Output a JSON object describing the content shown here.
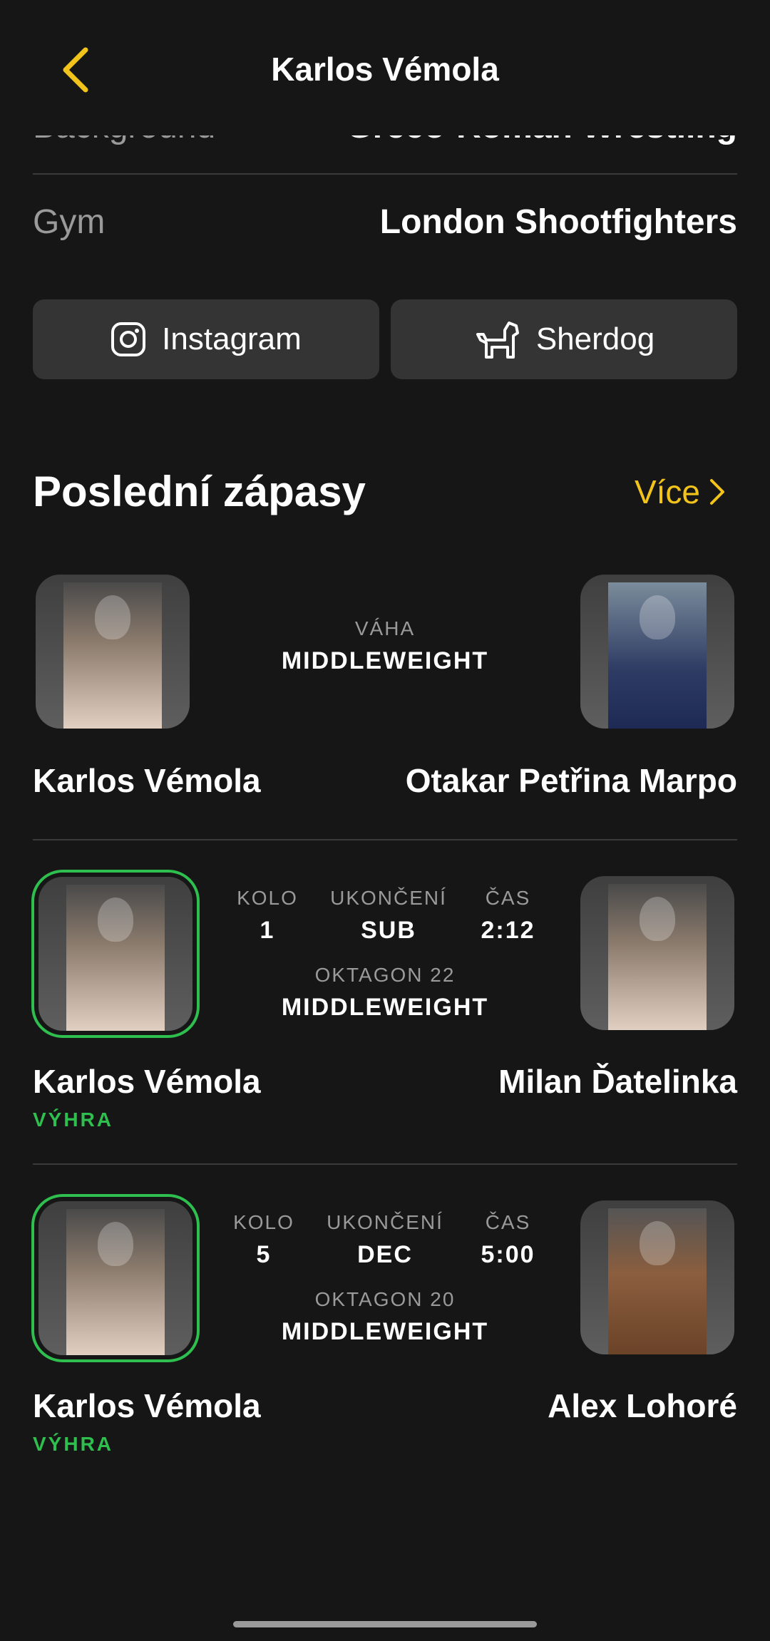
{
  "header": {
    "title": "Karlos Vémola"
  },
  "info": {
    "background_label": "Background",
    "background_value": "Greco-Roman Wrestling",
    "gym_label": "Gym",
    "gym_value": "London Shootfighters"
  },
  "links": {
    "instagram": "Instagram",
    "sherdog": "Sherdog"
  },
  "section": {
    "title": "Poslední zápasy",
    "more": "Více"
  },
  "colors": {
    "accent": "#f2c31b",
    "win": "#2fbf4f",
    "background": "#161616",
    "button": "#343434"
  },
  "fights": [
    {
      "weight_label": "VÁHA",
      "weight_class": "MIDDLEWEIGHT",
      "fighter_left": "Karlos Vémola",
      "fighter_right": "Otakar Petřina Marpo"
    },
    {
      "round_label": "KOLO",
      "round": "1",
      "method_label": "UKONČENÍ",
      "method": "SUB",
      "time_label": "ČAS",
      "time": "2:12",
      "event": "OKTAGON 22",
      "weight_class": "MIDDLEWEIGHT",
      "fighter_left": "Karlos Vémola",
      "fighter_right": "Milan Ďatelinka",
      "result": "VÝHRA"
    },
    {
      "round_label": "KOLO",
      "round": "5",
      "method_label": "UKONČENÍ",
      "method": "DEC",
      "time_label": "ČAS",
      "time": "5:00",
      "event": "OKTAGON 20",
      "weight_class": "MIDDLEWEIGHT",
      "fighter_left": "Karlos Vémola",
      "fighter_right": "Alex Lohoré",
      "result": "VÝHRA"
    }
  ]
}
